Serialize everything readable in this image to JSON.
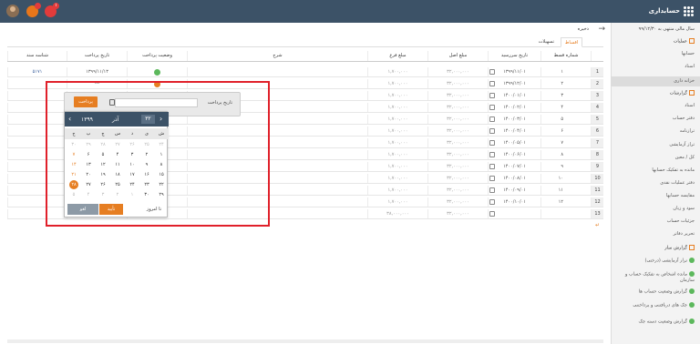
{
  "app": {
    "title": "حسابداری",
    "badge1": "",
    "badge2": "۱"
  },
  "breadcrumb": "ذخیره",
  "sidebar": {
    "fiscal": "سال مالی منتهی به ۹۹/۱۲/۳۰",
    "items": [
      {
        "label": "عملیات",
        "type": "group"
      },
      {
        "label": "حسابها",
        "type": "item"
      },
      {
        "label": "اسناد",
        "type": "item"
      },
      {
        "label": "خزانه داری",
        "type": "selected"
      },
      {
        "label": "گزارشات",
        "type": "group"
      },
      {
        "label": "اسناد",
        "type": "item"
      },
      {
        "label": "دفتر حساب",
        "type": "item"
      },
      {
        "label": "ترازنامه",
        "type": "item"
      },
      {
        "label": "تراز آزمایشی",
        "type": "item"
      },
      {
        "label": "کل / معین",
        "type": "item"
      },
      {
        "label": "مانده به تفکیک حسابها",
        "type": "item"
      },
      {
        "label": "دفتر عملیات نقدی",
        "type": "item"
      },
      {
        "label": "مقایسه حسابها",
        "type": "item"
      },
      {
        "label": "سود و زیان",
        "type": "item"
      },
      {
        "label": "جزئیات حساب",
        "type": "item"
      },
      {
        "label": "تحریر دفاتر",
        "type": "item"
      },
      {
        "label": "گزارش ساز",
        "type": "group"
      },
      {
        "label": "تراز آزمایشی (درختی)",
        "type": "report"
      },
      {
        "label": "مانده اشخاص به تفکیک حساب و سازمان",
        "type": "report"
      },
      {
        "label": "گزارش وضعیت حساب ها",
        "type": "report"
      },
      {
        "label": "چک های دریافتنی و پرداختنی",
        "type": "report"
      },
      {
        "label": "گزارش وضعیت دسته چک",
        "type": "report"
      }
    ]
  },
  "tabs": {
    "active": "اقساط",
    "other": "تسهیلات"
  },
  "table": {
    "headers": {
      "inst": "شماره قسط",
      "due": "تاریخ سررسید",
      "principal": "مبلغ اصل",
      "interest": "مبلغ فرع",
      "desc": "شرح",
      "status": "وضعیت پرداخت",
      "paydate": "تاریخ پرداخت",
      "docid": "شناسه سند"
    },
    "rows": [
      {
        "n": "1",
        "inst": "۱",
        "due": "۱۳۹۹/۱۱/۰۱",
        "principal": "۳۲,۰۰۰,۰۰۰",
        "interest": "۱,۷۰۰,۰۰۰",
        "paydate": "۱۳۹۹/۱۱/۱۳",
        "docid": "۵۱۷۱",
        "status": "paid"
      },
      {
        "n": "2",
        "inst": "۲",
        "due": "۱۳۹۹/۱۲/۰۱",
        "principal": "۳۲,۰۰۰,۰۰۰",
        "interest": "۱,۷۰۰,۰۰۰",
        "paydate": "---",
        "docid": "",
        "status": "pending"
      },
      {
        "n": "3",
        "inst": "۳",
        "due": "۱۴۰۰/۰۱/۰۱",
        "principal": "۳۲,۰۰۰,۰۰۰",
        "interest": "۱,۷۰۰,۰۰۰",
        "paydate": "",
        "docid": "",
        "status": ""
      },
      {
        "n": "4",
        "inst": "۴",
        "due": "۱۴۰۰/۰۲/۰۱",
        "principal": "۳۲,۰۰۰,۰۰۰",
        "interest": "۱,۷۰۰,۰۰۰",
        "paydate": "",
        "docid": "",
        "status": ""
      },
      {
        "n": "5",
        "inst": "۵",
        "due": "۱۴۰۰/۰۳/۰۱",
        "principal": "۳۲,۰۰۰,۰۰۰",
        "interest": "۱,۷۰۰,۰۰۰",
        "paydate": "",
        "docid": "",
        "status": ""
      },
      {
        "n": "6",
        "inst": "۶",
        "due": "۱۴۰۰/۰۴/۰۱",
        "principal": "۳۲,۰۰۰,۰۰۰",
        "interest": "۱,۷۰۰,۰۰۰",
        "paydate": "",
        "docid": "",
        "status": ""
      },
      {
        "n": "7",
        "inst": "۷",
        "due": "۱۴۰۰/۰۵/۰۱",
        "principal": "۳۲,۰۰۰,۰۰۰",
        "interest": "۱,۷۰۰,۰۰۰",
        "paydate": "",
        "docid": "",
        "status": ""
      },
      {
        "n": "8",
        "inst": "۸",
        "due": "۱۴۰۰/۰۶/۰۱",
        "principal": "۳۲,۰۰۰,۰۰۰",
        "interest": "۱,۷۰۰,۰۰۰",
        "paydate": "",
        "docid": "",
        "status": ""
      },
      {
        "n": "9",
        "inst": "۹",
        "due": "۱۴۰۰/۰۷/۰۱",
        "principal": "۳۲,۰۰۰,۰۰۰",
        "interest": "۱,۷۰۰,۰۰۰",
        "paydate": "",
        "docid": "",
        "status": ""
      },
      {
        "n": "10",
        "inst": "۱۰",
        "due": "۱۴۰۰/۰۸/۰۱",
        "principal": "۳۲,۰۰۰,۰۰۰",
        "interest": "۱,۷۰۰,۰۰۰",
        "paydate": "",
        "docid": "",
        "status": ""
      },
      {
        "n": "11",
        "inst": "۱۱",
        "due": "۱۴۰۰/۰۹/۰۱",
        "principal": "۳۲,۰۰۰,۰۰۰",
        "interest": "۱,۷۰۰,۰۰۰",
        "paydate": "",
        "docid": "",
        "status": ""
      },
      {
        "n": "12",
        "inst": "۱۲",
        "due": "۱۴۰۰/۱۰/۰۱",
        "principal": "۳۲,۰۰۰,۰۰۰",
        "interest": "۱,۷۰۰,۰۰۰",
        "paydate": "",
        "docid": "",
        "status": ""
      },
      {
        "n": "13",
        "inst": "",
        "due": "",
        "principal": "۳۲,۰۰۰,۰۰۰",
        "interest": "۳۸,۰۰۰,۰۰۰",
        "paydate": "",
        "docid": "",
        "status": ""
      }
    ]
  },
  "popup": {
    "label": "تاریخ پرداخت",
    "value": "",
    "button": "پرداخت"
  },
  "calendar": {
    "month": "آذر",
    "year": "۱۳۹۹",
    "month_num": "۳۲",
    "dow": [
      "ش",
      "ی",
      "د",
      "س",
      "چ",
      "پ",
      "ج"
    ],
    "weeks": [
      [
        "۲۴",
        "۲۵",
        "۲۶",
        "۲۷",
        "۲۸",
        "۲۹",
        "۳۰"
      ],
      [
        "۱",
        "۲",
        "۳",
        "۴",
        "۵",
        "۶",
        "۷"
      ],
      [
        "۸",
        "۹",
        "۱۰",
        "۱۱",
        "۱۲",
        "۱۳",
        "۱۴"
      ],
      [
        "۱۵",
        "۱۶",
        "۱۷",
        "۱۸",
        "۱۹",
        "۲۰",
        "۲۱"
      ],
      [
        "۲۲",
        "۲۳",
        "۲۴",
        "۲۵",
        "۲۶",
        "۲۷",
        "۲۸"
      ],
      [
        "۲۹",
        "۳۰",
        "۱",
        "۲",
        "۳",
        "۴",
        "۵"
      ]
    ],
    "today_label": "تا امروز",
    "confirm": "تأیید",
    "cancel": "لغو"
  },
  "colors": {
    "accent": "#e67e22",
    "header": "#3c5267",
    "alert": "#e0202a",
    "paid": "#5cb85c"
  }
}
